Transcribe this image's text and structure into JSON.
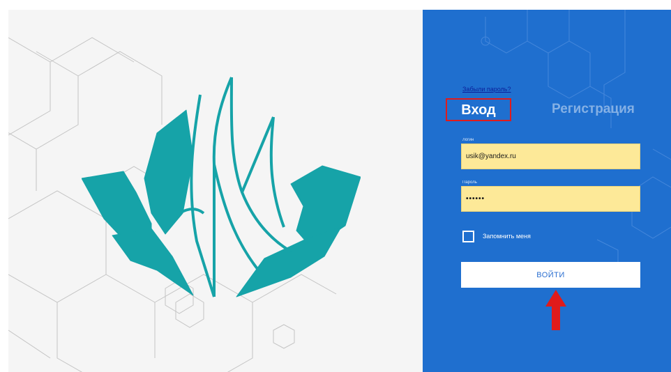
{
  "auth": {
    "forgot_password": "Забыли пароль?",
    "tabs": {
      "login": "Вход",
      "register": "Регистрация"
    },
    "login_label": "Логин",
    "login_value": "usik@yandex.ru",
    "password_label": "Пароль",
    "password_value": "••••••",
    "remember_label": "Запомнить меня",
    "remember_checked": false,
    "submit_label": "ВОЙТИ"
  },
  "colors": {
    "panel_blue": "#1f6fcf",
    "input_yellow": "#fde998",
    "logo_teal": "#16a3a8",
    "highlight_red": "#e01b1b"
  },
  "icons": [
    "logo-book-flame-icon",
    "red-arrow-up-icon"
  ]
}
